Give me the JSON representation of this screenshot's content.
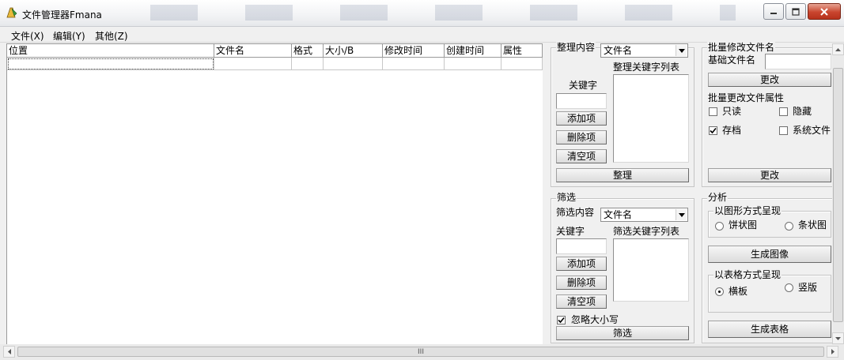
{
  "window": {
    "title": "文件管理器Fmana",
    "buttons": {
      "minimize_icon": "minimize-icon",
      "maximize_icon": "maximize-icon",
      "close_icon": "close-icon"
    }
  },
  "menu": [
    "文件(X)",
    "编辑(Y)",
    "其他(Z)"
  ],
  "table": {
    "columns": [
      "位置",
      "文件名",
      "格式",
      "大小/B",
      "修改时间",
      "创建时间",
      "属性"
    ]
  },
  "organize": {
    "content_label": "整理内容",
    "content_value": "文件名",
    "keyword_list_label": "整理关键字列表",
    "keyword_label": "关键字",
    "add_button": "添加项",
    "delete_button": "删除项",
    "clear_button": "清空项",
    "run_button": "整理"
  },
  "batch_rename": {
    "title": "批量修改文件名",
    "base_label": "基础文件名",
    "change_button": "更改"
  },
  "batch_attr": {
    "title": "批量更改文件属性",
    "readonly": "只读",
    "hidden": "隐藏",
    "archive": "存档",
    "system": "系统文件",
    "archive_checked": true,
    "change_button": "更改"
  },
  "filter": {
    "legend": "筛选",
    "content_label": "筛选内容",
    "content_value": "文件名",
    "keyword_label": "关键字",
    "keyword_list_label": "筛选关键字列表",
    "add_button": "添加项",
    "delete_button": "删除项",
    "clear_button": "清空项",
    "ignore_case": "忽略大小写",
    "ignore_case_checked": true,
    "run_button": "筛选"
  },
  "analysis": {
    "legend": "分析",
    "graph_group": "以图形方式呈现",
    "pie": "饼状图",
    "bar": "条状图",
    "graph_button": "生成图像",
    "table_group": "以表格方式呈现",
    "horizontal": "横板",
    "vertical": "竖版",
    "horizontal_selected": true,
    "table_button": "生成表格"
  },
  "scrollbar": {
    "thumb_grip": "III"
  },
  "colors": {
    "close_button": "#c9452e",
    "titlebar": "#f2f3f5",
    "face": "#f0f0f0"
  }
}
